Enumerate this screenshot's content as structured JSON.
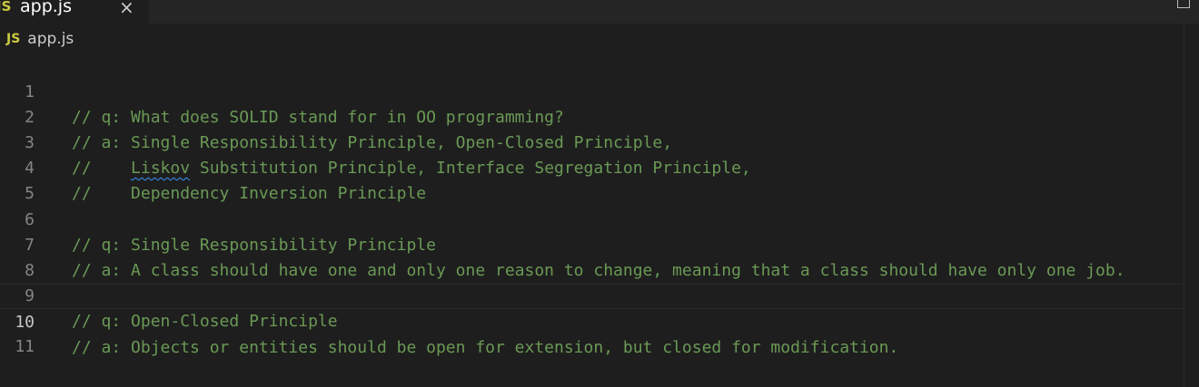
{
  "tab": {
    "icon": "js-file-icon",
    "icon_text": "JS",
    "name": "app.js",
    "close": "×"
  },
  "breadcrumb": {
    "icon_text": "JS",
    "file": "app.js"
  },
  "editor": {
    "comment_color": "#6a9955",
    "active_line": 10,
    "lines": [
      {
        "number": "1",
        "text": "// q: What does SOLID stand for in OO programming?"
      },
      {
        "number": "2",
        "text": "// a: Single Responsibility Principle, Open-Closed Principle,"
      },
      {
        "number": "3",
        "prefix": "//    ",
        "squiggle": "Liskov",
        "suffix": " Substitution Principle, Interface Segregation Principle,"
      },
      {
        "number": "4",
        "text": "//    Dependency Inversion Principle"
      },
      {
        "number": "5",
        "text": ""
      },
      {
        "number": "6",
        "text": "// q: Single Responsibility Principle"
      },
      {
        "number": "7",
        "text": "// a: A class should have one and only one reason to change, meaning that a class should have only one job."
      },
      {
        "number": "8",
        "text": ""
      },
      {
        "number": "9",
        "text": "// q: Open-Closed Principle"
      },
      {
        "number": "10",
        "text": "// a: Objects or entities should be open for extension, but closed for modification."
      },
      {
        "number": "11",
        "text": ""
      }
    ]
  }
}
